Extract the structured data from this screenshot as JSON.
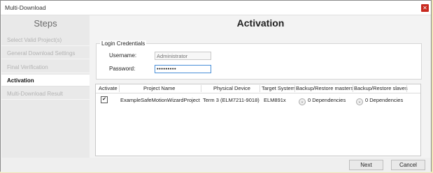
{
  "window": {
    "title": "Multi-Download",
    "close_icon": "close-icon"
  },
  "sidebar": {
    "title": "Steps",
    "items": [
      {
        "label": "Select Valid Project(s)"
      },
      {
        "label": "General Download Settings"
      },
      {
        "label": "Final Verification"
      },
      {
        "label": "Activation"
      },
      {
        "label": "Multi-Download Result"
      }
    ],
    "active_index": 3
  },
  "main": {
    "title": "Activation",
    "credentials": {
      "legend": "Login Credentials",
      "username_label": "Username:",
      "username_placeholder": "Administrator",
      "password_label": "Password:",
      "password_value": "•••••••••"
    },
    "grid": {
      "columns": [
        "Activate",
        "Project Name",
        "Physical Device",
        "Target System",
        "Backup/Restore masters",
        "Backup/Restore slaves"
      ],
      "rows": [
        {
          "activate": true,
          "project_name": "ExampleSafeMotionWizardProject",
          "physical_device": "Term 3 (ELM7211-9018)",
          "target_system": "ELM891x",
          "masters": "0 Dependencies",
          "slaves": "0 Dependencies"
        }
      ]
    }
  },
  "footer": {
    "next_label": "Next",
    "cancel_label": "Cancel"
  },
  "colors": {
    "close_button": "#c8291f",
    "focus_border": "#4a8fd8",
    "sidebar_bg": "#e9e9e9"
  }
}
